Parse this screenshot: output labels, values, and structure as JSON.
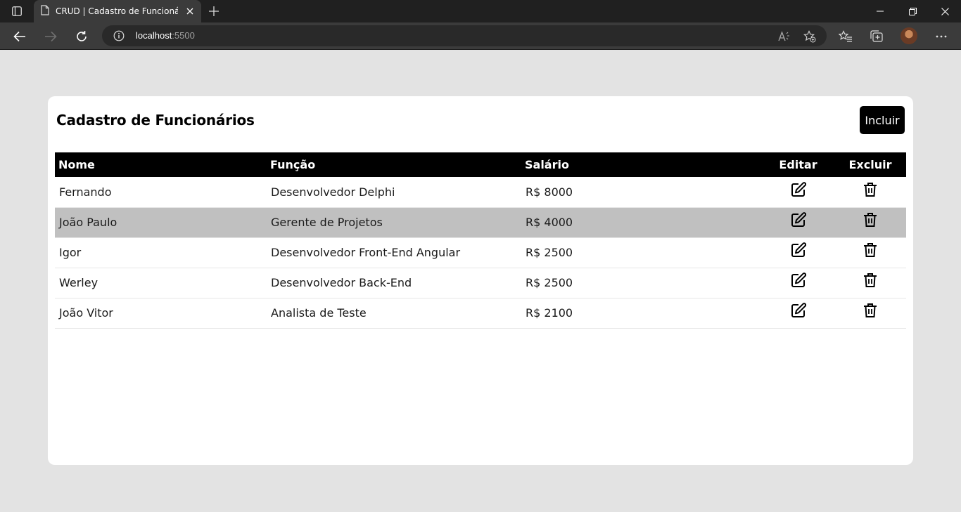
{
  "browser": {
    "tab_title": "CRUD | Cadastro de Funcionários",
    "url_host": "localhost",
    "url_port": ":5500"
  },
  "page": {
    "title": "Cadastro de Funcionários",
    "include_label": "Incluir"
  },
  "table": {
    "headers": {
      "nome": "Nome",
      "funcao": "Função",
      "salario": "Salário",
      "editar": "Editar",
      "excluir": "Excluir"
    },
    "rows": [
      {
        "nome": "Fernando",
        "funcao": "Desenvolvedor Delphi",
        "salario": "R$ 8000"
      },
      {
        "nome": "João Paulo",
        "funcao": "Gerente de Projetos",
        "salario": "R$ 4000"
      },
      {
        "nome": "Igor",
        "funcao": "Desenvolvedor Front-End Angular",
        "salario": "R$ 2500"
      },
      {
        "nome": "Werley",
        "funcao": "Desenvolvedor Back-End",
        "salario": "R$ 2500"
      },
      {
        "nome": "João Vitor",
        "funcao": "Analista de Teste",
        "salario": "R$ 2100"
      }
    ],
    "highlighted_row": 1
  },
  "icons": {
    "edit": "edit-icon",
    "delete": "trash-icon"
  },
  "colors": {
    "page_bg": "#e3e3e3",
    "header_bg": "#000000",
    "highlight_row": "#c0c0c0",
    "button_bg": "#000000"
  }
}
